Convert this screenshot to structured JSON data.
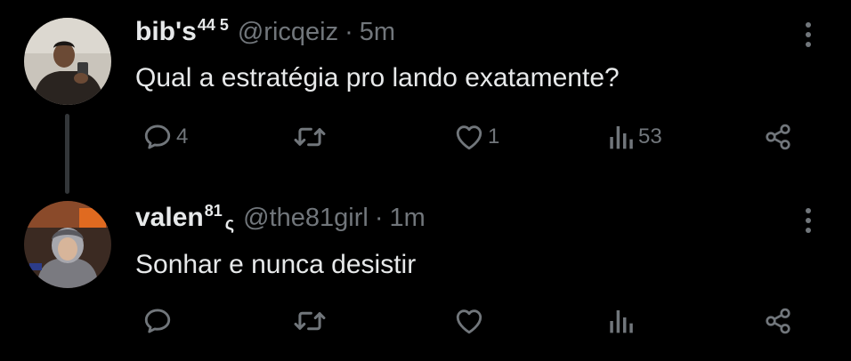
{
  "thread": [
    {
      "display_name": "bib's",
      "name_superscript": "44 5",
      "name_subscript": "",
      "handle": "@ricqeiz",
      "separator": "·",
      "time": "5m",
      "text": "Qual a estratégia pro lando exatamente?",
      "reply_count": "4",
      "retweet_count": "",
      "like_count": "1",
      "view_count": "53"
    },
    {
      "display_name": "valen",
      "name_superscript": "81",
      "name_subscript": "ς",
      "handle": "@the81girl",
      "separator": "·",
      "time": "1m",
      "text": "Sonhar e nunca desistir",
      "reply_count": "",
      "retweet_count": "",
      "like_count": "",
      "view_count": ""
    }
  ],
  "icons": {
    "reply": "speech-bubble-icon",
    "retweet": "retweet-arrows-icon",
    "like": "heart-icon",
    "views": "bar-chart-icon",
    "share": "share-nodes-icon",
    "more": "vertical-dots-icon"
  },
  "colors": {
    "background": "#000000",
    "primary_text": "#e7e9ea",
    "secondary_text": "#71767b",
    "thread_line": "#333639"
  }
}
